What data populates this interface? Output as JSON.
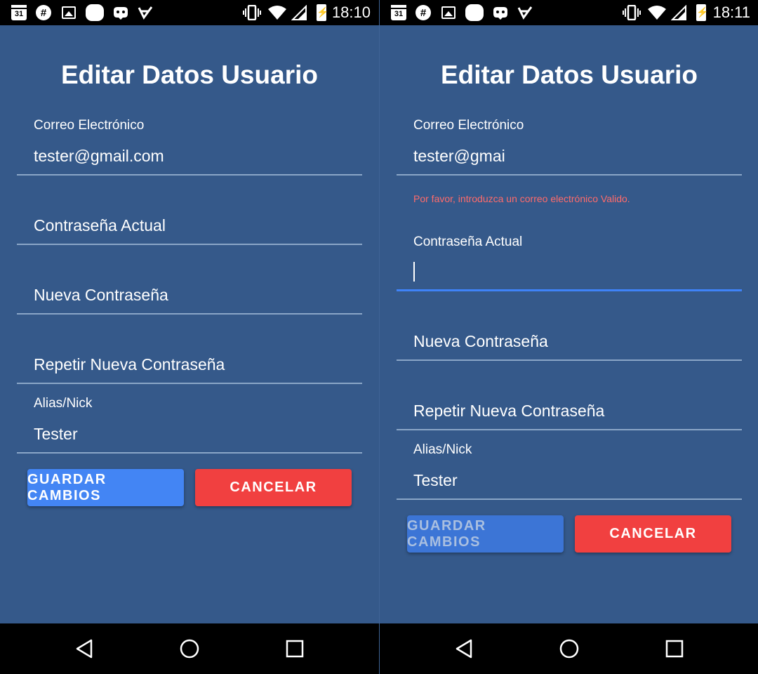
{
  "colors": {
    "background": "#35598a",
    "primary": "#4385f4",
    "danger": "#f14040",
    "error_text": "#ff6b6b",
    "focus_underline": "#3f83f8"
  },
  "screens": [
    {
      "status": {
        "time": "18:10",
        "calendar_day": "31"
      },
      "title": "Editar Datos Usuario",
      "email": {
        "label": "Correo Electrónico",
        "value": "tester@gmail.com"
      },
      "current_password": {
        "placeholder": "Contraseña Actual"
      },
      "new_password": {
        "placeholder": "Nueva Contraseña"
      },
      "repeat_password": {
        "placeholder": "Repetir Nueva Contraseña"
      },
      "alias": {
        "label": "Alias/Nick",
        "value": "Tester"
      },
      "save_label": "GUARDAR CAMBIOS",
      "cancel_label": "CANCELAR"
    },
    {
      "status": {
        "time": "18:11",
        "calendar_day": "31"
      },
      "title": "Editar Datos Usuario",
      "email": {
        "label": "Correo Electrónico",
        "value": "tester@gmai",
        "error": "Por favor, introduzca un correo electrónico Valido."
      },
      "current_password": {
        "label": "Contraseña Actual",
        "value": ""
      },
      "new_password": {
        "placeholder": "Nueva Contraseña"
      },
      "repeat_password": {
        "placeholder": "Repetir Nueva Contraseña"
      },
      "alias": {
        "label": "Alias/Nick",
        "value": "Tester"
      },
      "save_label": "GUARDAR CAMBIOS",
      "cancel_label": "CANCELAR"
    }
  ],
  "icons": {
    "status_left": [
      "calendar-icon",
      "slack-icon",
      "image-icon",
      "notification-icon",
      "game-icon",
      "check-icon"
    ],
    "status_right": [
      "vibrate-icon",
      "wifi-icon",
      "signal-icon",
      "battery-charging-icon"
    ],
    "nav": [
      "back-icon",
      "home-icon",
      "recents-icon"
    ]
  }
}
